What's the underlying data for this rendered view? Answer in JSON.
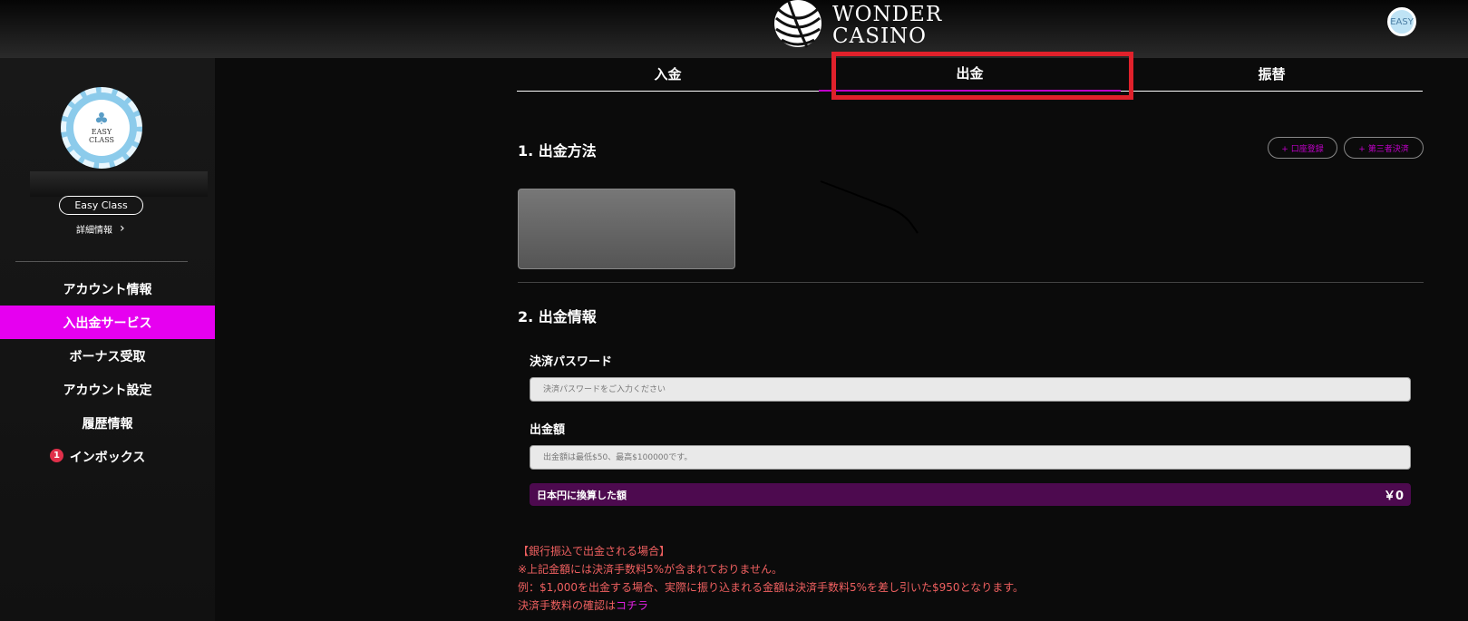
{
  "header": {
    "logo_line1": "WONDER",
    "logo_line2": "CASINO",
    "avatar_label": "EASY"
  },
  "sidebar": {
    "chip_line1": "EASY",
    "chip_line2": "CLASS",
    "level_badge": "Easy Class",
    "detail_link": "詳細情報",
    "detail_chevron": "›",
    "menu": [
      {
        "label": "アカウント情報",
        "active": false
      },
      {
        "label": "入出金サービス",
        "active": true
      },
      {
        "label": "ボーナス受取",
        "active": false
      },
      {
        "label": "アカウント設定",
        "active": false
      },
      {
        "label": "履歴情報",
        "active": false
      },
      {
        "label": "インボックス",
        "active": false
      }
    ],
    "inbox_badge_count": "1"
  },
  "tabs": [
    {
      "label": "入金"
    },
    {
      "label": "出金"
    },
    {
      "label": "振替"
    }
  ],
  "active_tab": "出金",
  "section1": {
    "title": "1. 出金方法",
    "register_account_button": "+ 口座登録",
    "third_party_button": "+ 第三者決済"
  },
  "section2": {
    "title": "2. 出金情報",
    "password_label": "決済パスワード",
    "password_placeholder": "決済パスワードをご入力ください",
    "amount_label": "出金額",
    "amount_placeholder": "出金額は最低$50、最高$100000です。",
    "convert_label": "日本円に換算した額",
    "convert_value": "￥0"
  },
  "notes": {
    "line1": "【銀行振込で出金される場合】",
    "line2": "※上記金額には決済手数料5%が含まれておりません。",
    "line3": "例：$1,000を出金する場合、実際に振り込まれる金額は決済手数料5%を差し引いた$950となります。",
    "line4_prefix": "決済手数料の確認は",
    "line4_link": "コチラ"
  },
  "colors": {
    "accent": "#e600f0",
    "highlight_box": "#e0212b",
    "convert_bar": "#4d0a4f",
    "notes_text": "#f06060"
  }
}
